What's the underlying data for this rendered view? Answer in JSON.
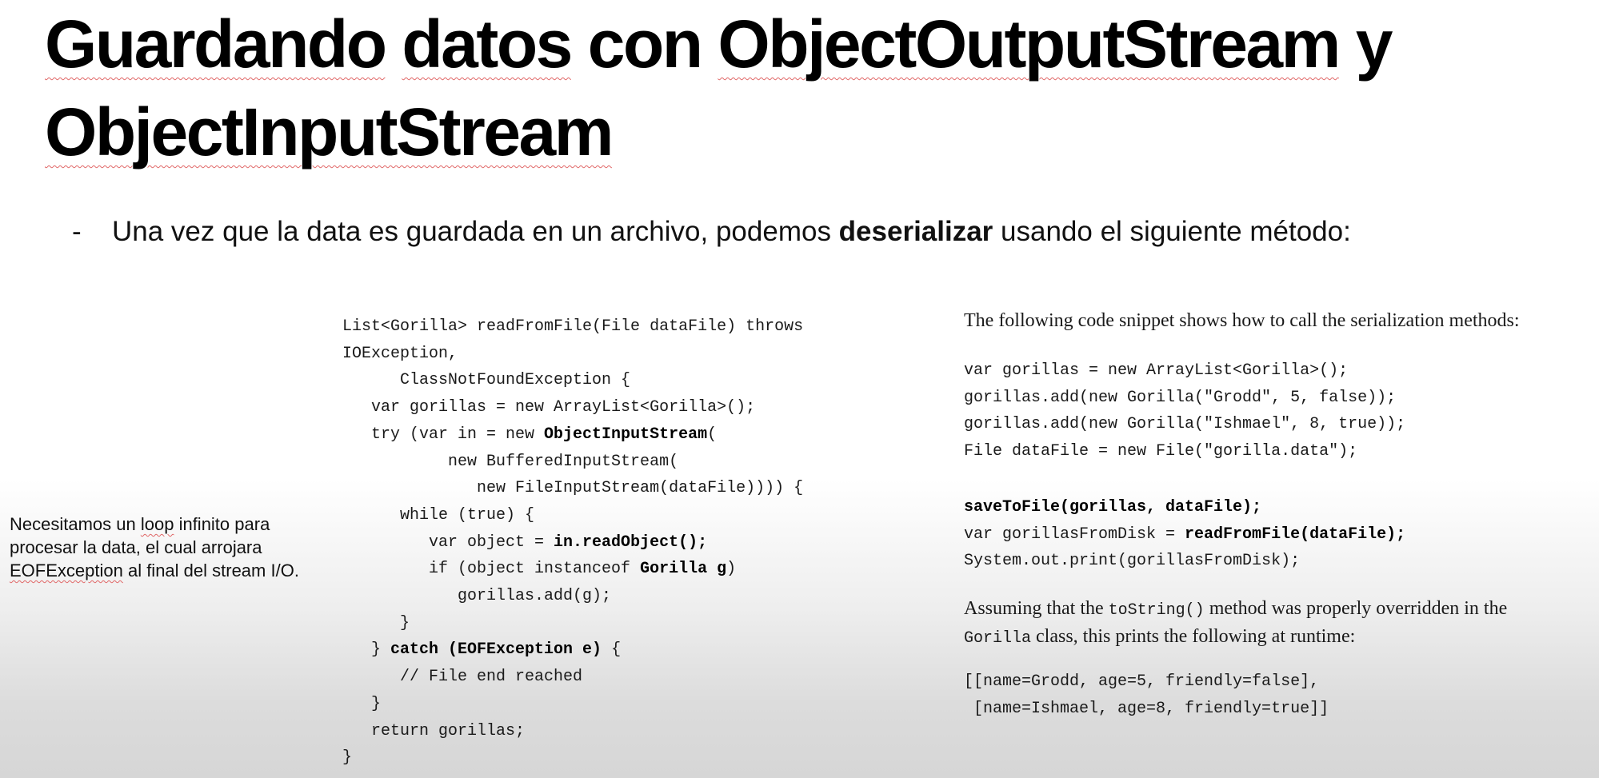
{
  "title": {
    "line1": [
      "Guardando",
      "datos",
      "con",
      "ObjectOutputStream",
      "y"
    ],
    "line2": [
      "ObjectInputStream"
    ]
  },
  "bullet": {
    "dash": "-",
    "before": "Una vez que la data es guardada en un archivo, podemos ",
    "bold": "deserializar",
    "after": " usando el siguiente método:"
  },
  "side_note": {
    "p1": "Necesitamos un ",
    "p2": "loop",
    "p3": " infinito para procesar la data, el cual arrojara ",
    "p4": "EOFException",
    "p5": " al final del stream I/O."
  },
  "code_left": [
    {
      "t": "List<Gorilla> readFromFile(File dataFile) throws"
    },
    {
      "t": "IOException,"
    },
    {
      "t": "      ClassNotFoundException {"
    },
    {
      "t": "   var gorillas = new ArrayList<Gorilla>();"
    },
    {
      "t": "   try (var in = new ",
      "b": "ObjectInputStream",
      "a": "("
    },
    {
      "t": "           new BufferedInputStream("
    },
    {
      "t": "              new FileInputStream(dataFile)))) {"
    },
    {
      "t": "      while (true) {"
    },
    {
      "t": "         var object = ",
      "b": "in.readObject();",
      "a": ""
    },
    {
      "t": "         if (object instanceof ",
      "b": "Gorilla g",
      "a": ")"
    },
    {
      "t": "            gorillas.add(g);"
    },
    {
      "t": "      }"
    },
    {
      "t": "   } ",
      "b": "catch (EOFException e)",
      "a": " {"
    },
    {
      "t": "      // File end reached"
    },
    {
      "t": "   }"
    },
    {
      "t": "   return gorillas;"
    },
    {
      "t": "}"
    }
  ],
  "right_panel": {
    "intro": "The following code snippet shows how to call the serialization methods:",
    "snippet1": [
      "var gorillas = new ArrayList<Gorilla>();",
      "gorillas.add(new Gorilla(\"Grodd\", 5, false));",
      "gorillas.add(new Gorilla(\"Ishmael\", 8, true));",
      "File dataFile = new File(\"gorilla.data\");"
    ],
    "snippet2": [
      {
        "t": "",
        "b": "saveToFile(gorillas, dataFile);",
        "a": ""
      },
      {
        "t": "var gorillasFromDisk = ",
        "b": "readFromFile(dataFile);",
        "a": ""
      },
      {
        "t": "System.out.print(gorillasFromDisk);"
      }
    ],
    "assume": {
      "p1": "Assuming that the ",
      "c1": "toString()",
      "p2": " method was properly overridden in the",
      "c2": "Gorilla",
      "p3": " class, this prints the following at runtime:"
    },
    "output": [
      "[[name=Grodd, age=5, friendly=false],",
      " [name=Ishmael, age=8, friendly=true]]"
    ]
  }
}
